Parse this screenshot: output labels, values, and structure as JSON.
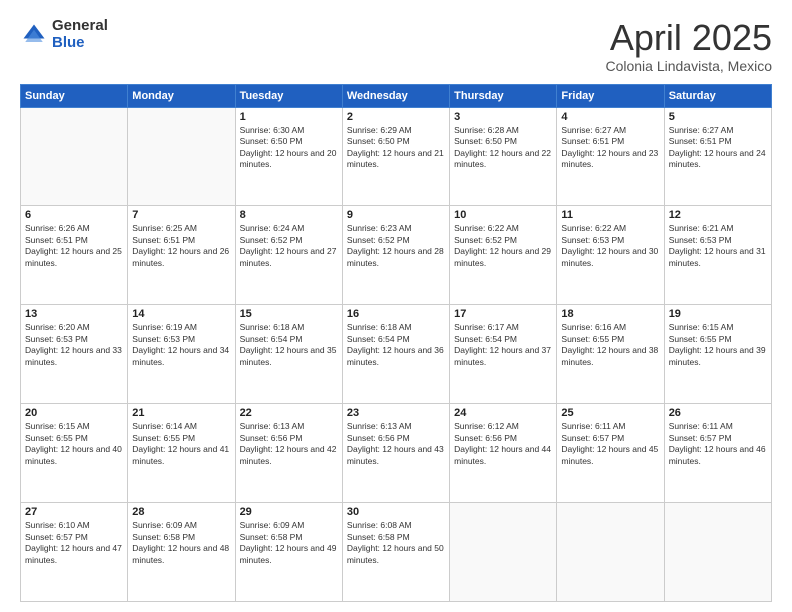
{
  "logo": {
    "general": "General",
    "blue": "Blue"
  },
  "title": {
    "month": "April 2025",
    "location": "Colonia Lindavista, Mexico"
  },
  "weekdays": [
    "Sunday",
    "Monday",
    "Tuesday",
    "Wednesday",
    "Thursday",
    "Friday",
    "Saturday"
  ],
  "weeks": [
    [
      {
        "day": "",
        "info": ""
      },
      {
        "day": "",
        "info": ""
      },
      {
        "day": "1",
        "info": "Sunrise: 6:30 AM\nSunset: 6:50 PM\nDaylight: 12 hours and 20 minutes."
      },
      {
        "day": "2",
        "info": "Sunrise: 6:29 AM\nSunset: 6:50 PM\nDaylight: 12 hours and 21 minutes."
      },
      {
        "day": "3",
        "info": "Sunrise: 6:28 AM\nSunset: 6:50 PM\nDaylight: 12 hours and 22 minutes."
      },
      {
        "day": "4",
        "info": "Sunrise: 6:27 AM\nSunset: 6:51 PM\nDaylight: 12 hours and 23 minutes."
      },
      {
        "day": "5",
        "info": "Sunrise: 6:27 AM\nSunset: 6:51 PM\nDaylight: 12 hours and 24 minutes."
      }
    ],
    [
      {
        "day": "6",
        "info": "Sunrise: 6:26 AM\nSunset: 6:51 PM\nDaylight: 12 hours and 25 minutes."
      },
      {
        "day": "7",
        "info": "Sunrise: 6:25 AM\nSunset: 6:51 PM\nDaylight: 12 hours and 26 minutes."
      },
      {
        "day": "8",
        "info": "Sunrise: 6:24 AM\nSunset: 6:52 PM\nDaylight: 12 hours and 27 minutes."
      },
      {
        "day": "9",
        "info": "Sunrise: 6:23 AM\nSunset: 6:52 PM\nDaylight: 12 hours and 28 minutes."
      },
      {
        "day": "10",
        "info": "Sunrise: 6:22 AM\nSunset: 6:52 PM\nDaylight: 12 hours and 29 minutes."
      },
      {
        "day": "11",
        "info": "Sunrise: 6:22 AM\nSunset: 6:53 PM\nDaylight: 12 hours and 30 minutes."
      },
      {
        "day": "12",
        "info": "Sunrise: 6:21 AM\nSunset: 6:53 PM\nDaylight: 12 hours and 31 minutes."
      }
    ],
    [
      {
        "day": "13",
        "info": "Sunrise: 6:20 AM\nSunset: 6:53 PM\nDaylight: 12 hours and 33 minutes."
      },
      {
        "day": "14",
        "info": "Sunrise: 6:19 AM\nSunset: 6:53 PM\nDaylight: 12 hours and 34 minutes."
      },
      {
        "day": "15",
        "info": "Sunrise: 6:18 AM\nSunset: 6:54 PM\nDaylight: 12 hours and 35 minutes."
      },
      {
        "day": "16",
        "info": "Sunrise: 6:18 AM\nSunset: 6:54 PM\nDaylight: 12 hours and 36 minutes."
      },
      {
        "day": "17",
        "info": "Sunrise: 6:17 AM\nSunset: 6:54 PM\nDaylight: 12 hours and 37 minutes."
      },
      {
        "day": "18",
        "info": "Sunrise: 6:16 AM\nSunset: 6:55 PM\nDaylight: 12 hours and 38 minutes."
      },
      {
        "day": "19",
        "info": "Sunrise: 6:15 AM\nSunset: 6:55 PM\nDaylight: 12 hours and 39 minutes."
      }
    ],
    [
      {
        "day": "20",
        "info": "Sunrise: 6:15 AM\nSunset: 6:55 PM\nDaylight: 12 hours and 40 minutes."
      },
      {
        "day": "21",
        "info": "Sunrise: 6:14 AM\nSunset: 6:55 PM\nDaylight: 12 hours and 41 minutes."
      },
      {
        "day": "22",
        "info": "Sunrise: 6:13 AM\nSunset: 6:56 PM\nDaylight: 12 hours and 42 minutes."
      },
      {
        "day": "23",
        "info": "Sunrise: 6:13 AM\nSunset: 6:56 PM\nDaylight: 12 hours and 43 minutes."
      },
      {
        "day": "24",
        "info": "Sunrise: 6:12 AM\nSunset: 6:56 PM\nDaylight: 12 hours and 44 minutes."
      },
      {
        "day": "25",
        "info": "Sunrise: 6:11 AM\nSunset: 6:57 PM\nDaylight: 12 hours and 45 minutes."
      },
      {
        "day": "26",
        "info": "Sunrise: 6:11 AM\nSunset: 6:57 PM\nDaylight: 12 hours and 46 minutes."
      }
    ],
    [
      {
        "day": "27",
        "info": "Sunrise: 6:10 AM\nSunset: 6:57 PM\nDaylight: 12 hours and 47 minutes."
      },
      {
        "day": "28",
        "info": "Sunrise: 6:09 AM\nSunset: 6:58 PM\nDaylight: 12 hours and 48 minutes."
      },
      {
        "day": "29",
        "info": "Sunrise: 6:09 AM\nSunset: 6:58 PM\nDaylight: 12 hours and 49 minutes."
      },
      {
        "day": "30",
        "info": "Sunrise: 6:08 AM\nSunset: 6:58 PM\nDaylight: 12 hours and 50 minutes."
      },
      {
        "day": "",
        "info": ""
      },
      {
        "day": "",
        "info": ""
      },
      {
        "day": "",
        "info": ""
      }
    ]
  ]
}
